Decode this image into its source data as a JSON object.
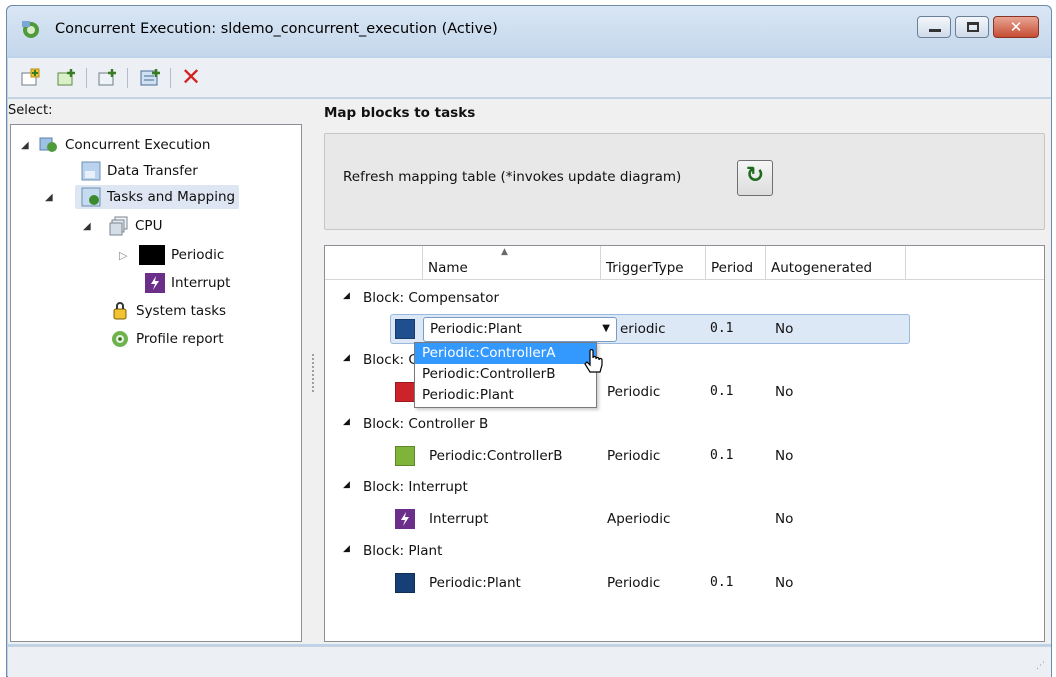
{
  "window": {
    "title": "Concurrent Execution: sldemo_concurrent_execution (Active)"
  },
  "left": {
    "select_label": "Select:",
    "tree": [
      {
        "label": "Concurrent Execution",
        "icon": "concurrent-execution-icon"
      },
      {
        "label": "Data Transfer",
        "icon": "data-transfer-icon"
      },
      {
        "label": "Tasks and Mapping",
        "icon": "tasks-mapping-icon"
      },
      {
        "label": "CPU",
        "icon": "cpu-icon"
      },
      {
        "label": "Periodic",
        "icon": "periodic-icon"
      },
      {
        "label": "Interrupt",
        "icon": "interrupt-icon"
      },
      {
        "label": "System tasks",
        "icon": "system-tasks-icon"
      },
      {
        "label": "Profile report",
        "icon": "profile-report-icon"
      }
    ]
  },
  "main": {
    "title": "Map blocks to tasks",
    "refresh_label": "Refresh mapping table (*invokes update diagram)",
    "columns": [
      "Name",
      "TriggerType",
      "Period",
      "Autogenerated"
    ],
    "groups": [
      {
        "label": "Block: Compensator"
      },
      {
        "label": "Block: C"
      },
      {
        "label": "Block: Controller B"
      },
      {
        "label": "Block: Interrupt"
      },
      {
        "label": "Block: Plant"
      }
    ],
    "rows": [
      {
        "name": "",
        "trigger": "eriodic",
        "period": "0.1",
        "auto": "No",
        "color": "#1f4f8f"
      },
      {
        "name": "",
        "trigger": "Periodic",
        "period": "0.1",
        "auto": "No",
        "color": "#cc2229"
      },
      {
        "name": "Periodic:ControllerB",
        "trigger": "Periodic",
        "period": "0.1",
        "auto": "No",
        "color": "#7fb33a"
      },
      {
        "name": "Interrupt",
        "trigger": "Aperiodic",
        "period": "",
        "auto": "No",
        "color": "#6b2f8a"
      },
      {
        "name": "Periodic:Plant",
        "trigger": "Periodic",
        "period": "0.1",
        "auto": "No",
        "color": "#153f75"
      }
    ],
    "dropdown": {
      "selected": "Periodic:Plant",
      "options": [
        "Periodic:ControllerA",
        "Periodic:ControllerB",
        "Periodic:Plant"
      ]
    }
  }
}
